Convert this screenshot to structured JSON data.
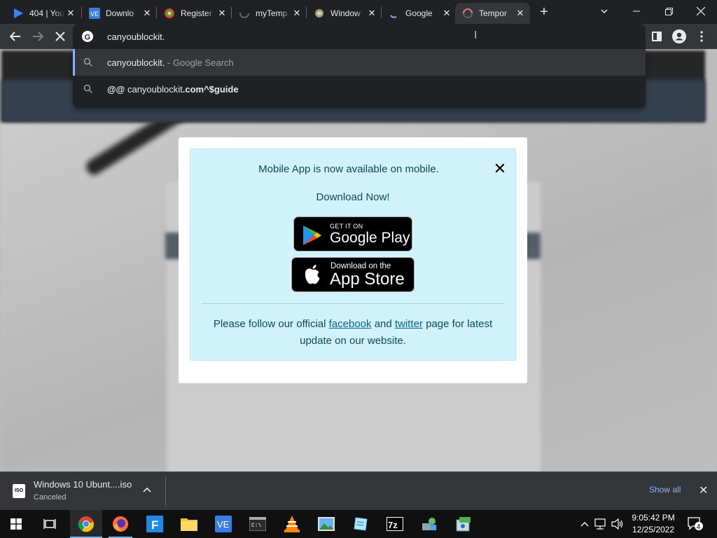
{
  "browser": {
    "tabs": [
      {
        "title": "404 | You",
        "icon": "play-icon",
        "active": false
      },
      {
        "title": "Downlo",
        "icon": "ve-icon",
        "active": false
      },
      {
        "title": "Register",
        "icon": "leaf-icon",
        "active": false
      },
      {
        "title": "myTemp",
        "icon": "spinner-icon",
        "active": false
      },
      {
        "title": "Window",
        "icon": "swirl-icon",
        "active": false
      },
      {
        "title": "Google",
        "icon": "loading-icon",
        "active": false
      },
      {
        "title": "Tempor",
        "icon": "loading-arc-icon",
        "active": true
      }
    ],
    "omnibox_text": "canyoublockit.",
    "suggestions": [
      {
        "main": "canyoublockit.",
        "suffix": " - Google Search",
        "icon": "search-icon"
      },
      {
        "prefix": "@@ ",
        "main": "canyoublockit",
        "bold_tail": ".com^$guide",
        "icon": "search-icon"
      }
    ]
  },
  "modal": {
    "message": "Mobile App is now available on mobile.",
    "cta": "Download Now!",
    "google_play": {
      "small": "GET IT ON",
      "big": "Google Play"
    },
    "app_store": {
      "small": "Download on the",
      "big": "App Store"
    },
    "footer_before": "Please follow our official ",
    "facebook": "facebook",
    "footer_mid": " and ",
    "twitter": "twitter",
    "footer_after": " page for latest update on our website."
  },
  "downloads": {
    "file_name": "Windows 10 Ubunt....iso",
    "status": "Canceled",
    "file_badge": "ISO",
    "show_all": "Show all"
  },
  "taskbar": {
    "apps": [
      "chrome-icon",
      "firefox-icon",
      "f-app-icon",
      "folder-icon",
      "ve-icon",
      "terminal-icon",
      "vlc-icon",
      "photo-icon",
      "notepad-icon",
      "7zip-icon",
      "network-app-icon",
      "installer-icon"
    ],
    "time": "9:05:42 PM",
    "date": "12/25/2022",
    "notification_count": "4"
  },
  "colors": {
    "accent": "#8ab4f8",
    "alert_bg": "#d1f2fb",
    "link": "#0b5e8e"
  }
}
